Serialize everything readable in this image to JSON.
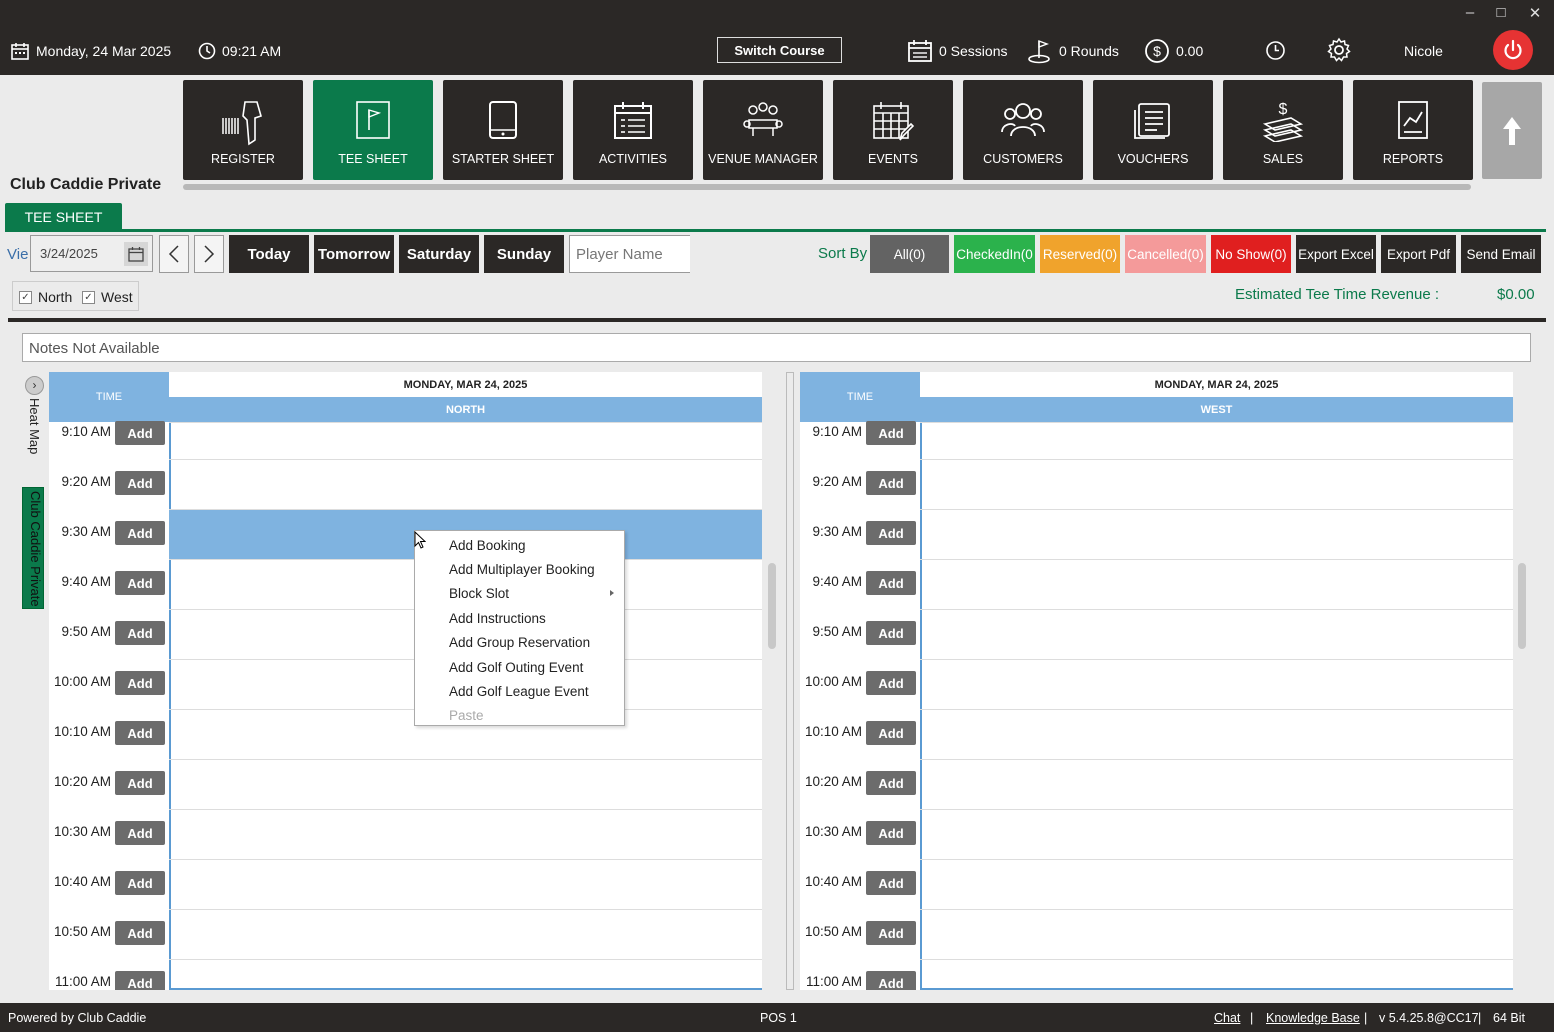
{
  "window": {
    "minimize": "‒",
    "maximize": "□",
    "close": "✕"
  },
  "topbar": {
    "date": "Monday,  24 Mar 2025",
    "time": "09:21 AM",
    "switch_course": "Switch Course",
    "sessions": "0 Sessions",
    "rounds": "0 Rounds",
    "balance": "0.00",
    "user": "Nicole"
  },
  "brand": "Club Caddie Private",
  "modules": [
    {
      "label": "REGISTER",
      "icon": "barcode-scanner-icon"
    },
    {
      "label": "TEE SHEET",
      "icon": "flag-sheet-icon",
      "active": true
    },
    {
      "label": "STARTER SHEET",
      "icon": "tablet-icon"
    },
    {
      "label": "ACTIVITIES",
      "icon": "calendar-list-icon"
    },
    {
      "label": "VENUE MANAGER",
      "icon": "venue-table-icon"
    },
    {
      "label": "EVENTS",
      "icon": "calendar-edit-icon"
    },
    {
      "label": "CUSTOMERS",
      "icon": "users-icon"
    },
    {
      "label": "VOUCHERS",
      "icon": "voucher-icon"
    },
    {
      "label": "SALES",
      "icon": "money-stack-icon"
    },
    {
      "label": "REPORTS",
      "icon": "report-chart-icon"
    }
  ],
  "tab": "TEE SHEET",
  "toolbar": {
    "view_label": "Vie",
    "date_value": "3/24/2025",
    "prev": "‹",
    "next": "›",
    "today": "Today",
    "tomorrow": "Tomorrow",
    "saturday": "Saturday",
    "sunday": "Sunday",
    "player_placeholder": "Player Name",
    "sort_by": "Sort By",
    "all": "All(0)",
    "checkedin": "CheckedIn(0",
    "reserved": "Reserved(0)",
    "cancelled": "Cancelled(0)",
    "noshow": "No Show(0)",
    "export_excel": "Export Excel",
    "export_pdf": "Export Pdf",
    "send_email": "Send Email"
  },
  "courses_filter": {
    "north": "North",
    "west": "West",
    "north_checked": true,
    "west_checked": true
  },
  "revenue": {
    "label": "Estimated Tee Time Revenue :",
    "value": "$0.00"
  },
  "notes": "Notes Not Available",
  "side": {
    "arrow": "›",
    "heat_map": "Heat Map",
    "club": "Club Caddie Private"
  },
  "grid_north": {
    "time_header": "TIME",
    "date": "MONDAY, MAR 24, 2025",
    "course": "NORTH"
  },
  "grid_west": {
    "time_header": "TIME",
    "date": "MONDAY, MAR 24, 2025",
    "course": "WEST"
  },
  "add_label": "Add",
  "times": [
    "9:10 AM",
    "9:20 AM",
    "9:30 AM",
    "9:40 AM",
    "9:50 AM",
    "10:00 AM",
    "10:10 AM",
    "10:20 AM",
    "10:30 AM",
    "10:40 AM",
    "10:50 AM",
    "11:00 AM"
  ],
  "context_menu": [
    {
      "label": "Add Booking"
    },
    {
      "label": "Add Multiplayer Booking"
    },
    {
      "label": "Block Slot",
      "submenu": true
    },
    {
      "label": "Add Instructions"
    },
    {
      "label": "Add Group Reservation"
    },
    {
      "label": "Add Golf Outing Event"
    },
    {
      "label": "Add Golf League Event"
    },
    {
      "label": "Paste",
      "disabled": true
    }
  ],
  "footer": {
    "powered": "Powered by Club Caddie",
    "pos": "POS 1",
    "chat": "Chat",
    "sep1": "|",
    "kb": "Knowledge Base",
    "sep2": "|",
    "version": "v 5.4.25.8@CC17",
    "sep3": "|",
    "bits": "64 Bit"
  },
  "colors": {
    "dark": "#2b2826",
    "green": "#0b7a4b",
    "checkedin": "#2bb24c",
    "reserved": "#f0a32c",
    "cancelled": "#f49a9a",
    "noshow": "#e01f1f",
    "grid_header": "#7fb3e0",
    "power": "#e63333"
  }
}
